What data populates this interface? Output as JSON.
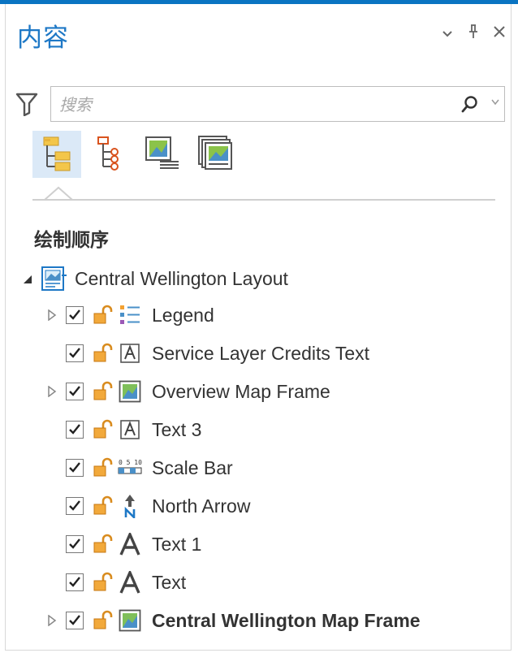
{
  "pane": {
    "title": "内容",
    "controls": [
      "chevron-down-icon",
      "pin-icon",
      "close-icon"
    ]
  },
  "search": {
    "placeholder": "搜索",
    "value": ""
  },
  "view_tabs": [
    {
      "name": "drawing-order-tab",
      "icon": "list-by-drawing-order-icon",
      "active": true
    },
    {
      "name": "selection-tab",
      "icon": "list-by-selection-icon",
      "active": false
    },
    {
      "name": "source-tab",
      "icon": "list-by-source-icon",
      "active": false
    },
    {
      "name": "snapping-tab",
      "icon": "list-by-map-frames-icon",
      "active": false
    }
  ],
  "section_heading": "绘制顺序",
  "tree": {
    "root": {
      "label": "Central Wellington Layout",
      "icon": "layout-icon",
      "expanded": true
    },
    "items": [
      {
        "label": "Legend",
        "icon": "legend-icon",
        "expandable": true,
        "checked": true,
        "bold": false
      },
      {
        "label": "Service Layer Credits Text",
        "icon": "text-box-icon",
        "expandable": false,
        "checked": true,
        "bold": false
      },
      {
        "label": "Overview Map Frame",
        "icon": "map-frame-icon",
        "expandable": true,
        "checked": true,
        "bold": false
      },
      {
        "label": "Text 3",
        "icon": "text-box-icon",
        "expandable": false,
        "checked": true,
        "bold": false
      },
      {
        "label": "Scale Bar",
        "icon": "scale-bar-icon",
        "expandable": false,
        "checked": true,
        "bold": false
      },
      {
        "label": "North Arrow",
        "icon": "north-arrow-icon",
        "expandable": false,
        "checked": true,
        "bold": false
      },
      {
        "label": "Text 1",
        "icon": "text-icon",
        "expandable": false,
        "checked": true,
        "bold": false
      },
      {
        "label": "Text",
        "icon": "text-icon",
        "expandable": false,
        "checked": true,
        "bold": false
      },
      {
        "label": "Central Wellington Map Frame",
        "icon": "map-frame-icon",
        "expandable": true,
        "checked": true,
        "bold": true
      }
    ]
  },
  "colors": {
    "accent": "#0a74c2",
    "title": "#1e78c6",
    "active_tab_bg": "#dbe9f7",
    "lock": "#d98c1f"
  }
}
